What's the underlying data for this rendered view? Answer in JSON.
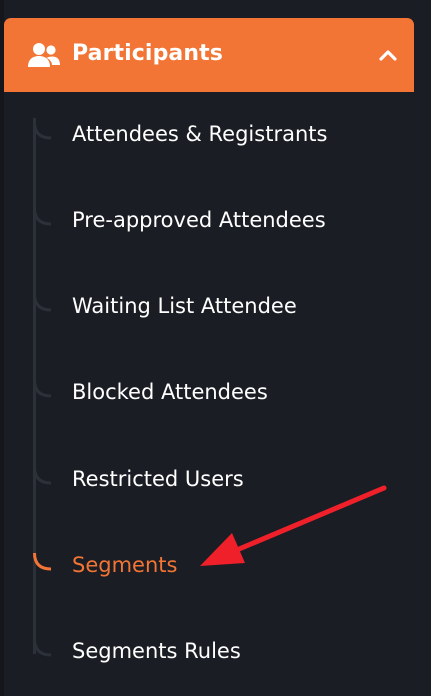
{
  "accent_color": "#f27535",
  "header": {
    "icon": "users-icon",
    "label": "Participants",
    "chevron_icon": "chevron-up-icon"
  },
  "menu": {
    "items": [
      {
        "label": "Attendees & Registrants",
        "active": false
      },
      {
        "label": "Pre-approved Attendees",
        "active": false
      },
      {
        "label": "Waiting List Attendee",
        "active": false
      },
      {
        "label": "Blocked Attendees",
        "active": false
      },
      {
        "label": "Restricted Users",
        "active": false
      },
      {
        "label": "Segments",
        "active": true
      },
      {
        "label": "Segments Rules",
        "active": false
      }
    ]
  },
  "annotation": {
    "icon": "red-arrow-icon",
    "color": "#f0202a"
  }
}
